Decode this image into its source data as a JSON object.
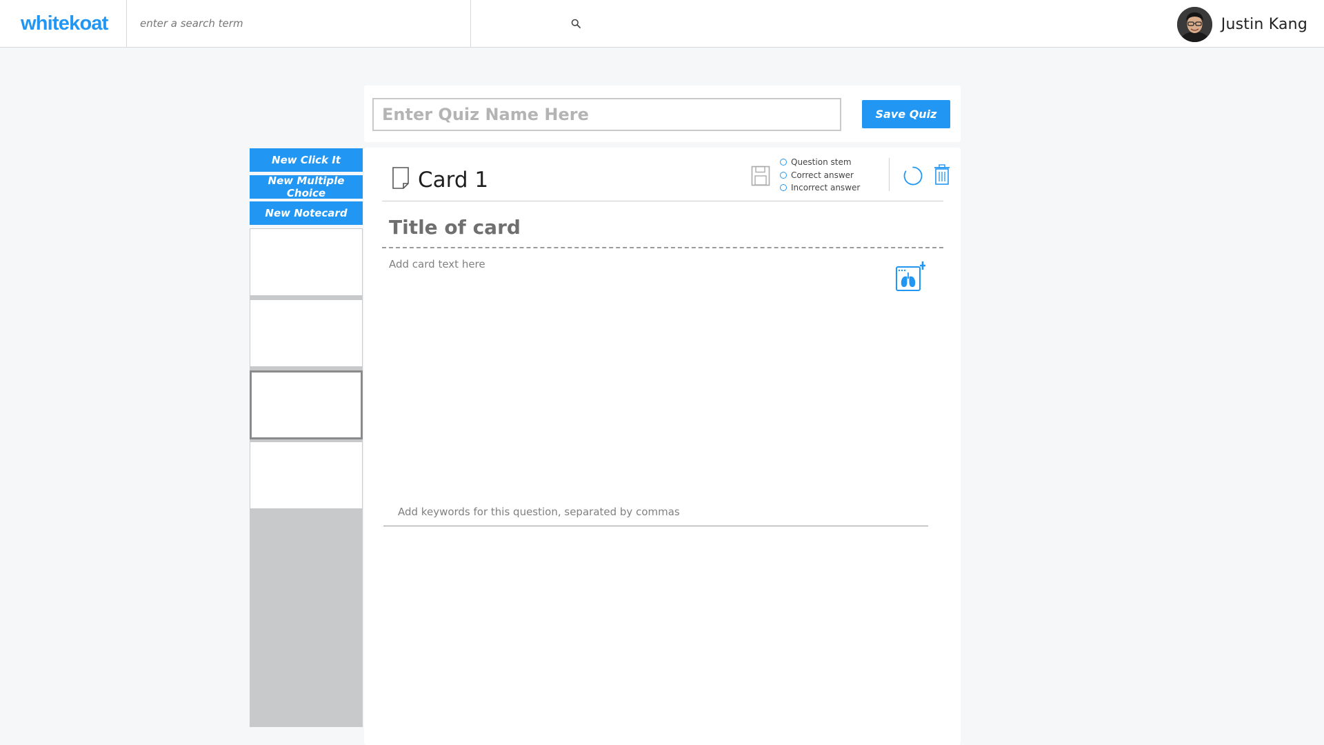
{
  "header": {
    "logo": "whitekoat",
    "search_placeholder": "enter a search term",
    "user_name": "Justin Kang"
  },
  "sidebar": {
    "buttons": [
      {
        "label": "New Click It"
      },
      {
        "label": "New Multiple Choice"
      },
      {
        "label": "New Notecard"
      }
    ],
    "thumbnail_count": 4,
    "active_thumbnail": 3
  },
  "quiz": {
    "name_placeholder": "Enter Quiz Name Here",
    "save_label": "Save Quiz"
  },
  "card": {
    "label": "Card 1",
    "legend": [
      {
        "label": "Question stem"
      },
      {
        "label": "Correct answer"
      },
      {
        "label": "Incorrect answer"
      }
    ],
    "title_placeholder": "Title of card",
    "text_placeholder": "Add card text here",
    "keywords_placeholder": "Add keywords for this question, separated by commas"
  },
  "colors": {
    "accent": "#2196f3",
    "background": "#f6f7f9",
    "thumb_stack": "#c8c9cb"
  },
  "icons": [
    "search-icon",
    "note-icon",
    "floppy-disk-icon",
    "refresh-icon",
    "trash-icon",
    "add-image-icon"
  ]
}
